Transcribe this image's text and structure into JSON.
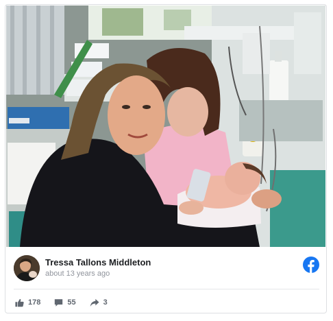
{
  "post": {
    "author_name": "Tressa Tallons Middleton",
    "timestamp": "about 13 years ago",
    "stats": {
      "likes": "178",
      "comments": "55",
      "shares": "3"
    }
  },
  "colors": {
    "facebook_blue": "#1877f2",
    "meta_text": "#90949c",
    "stat_text": "#606770"
  },
  "icons": [
    "facebook-logo-icon",
    "like-icon",
    "comment-icon",
    "share-icon"
  ]
}
